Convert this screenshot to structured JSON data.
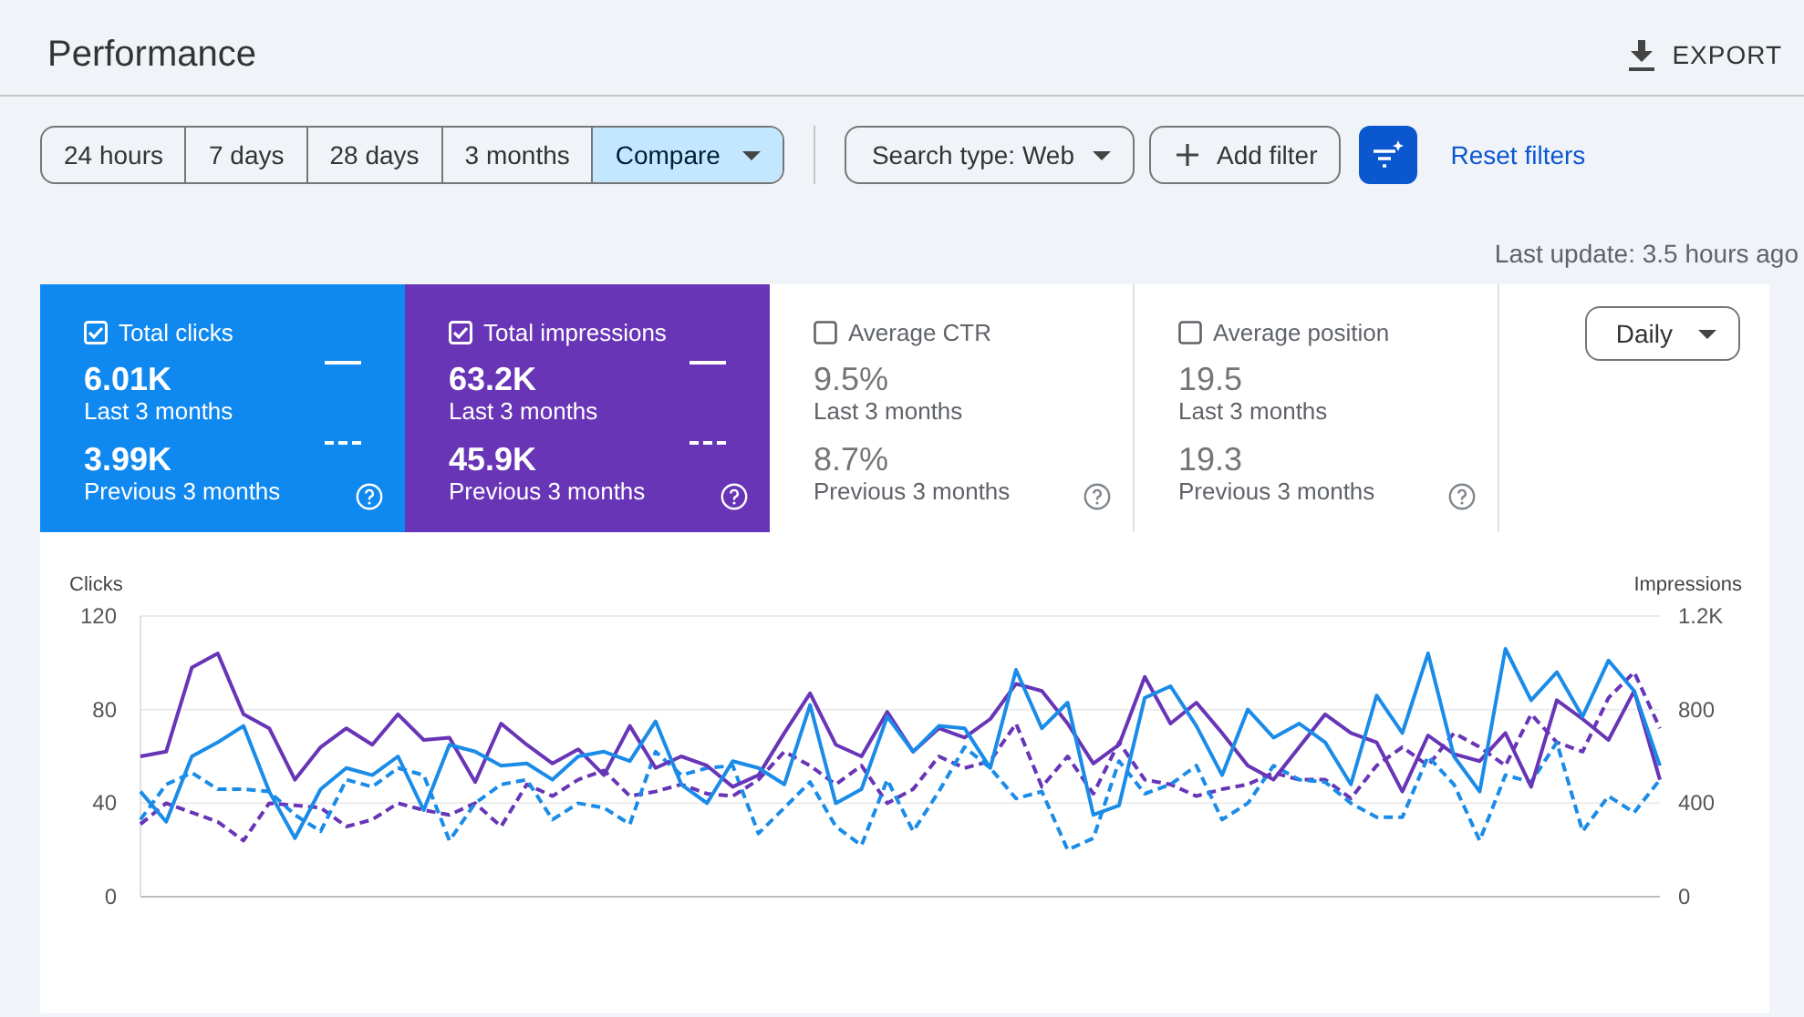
{
  "header": {
    "title": "Performance",
    "export_label": "EXPORT"
  },
  "date_ranges": [
    {
      "label": "24 hours",
      "selected": false,
      "kind": "option"
    },
    {
      "label": "7 days",
      "selected": false,
      "kind": "option"
    },
    {
      "label": "28 days",
      "selected": false,
      "kind": "option"
    },
    {
      "label": "3 months",
      "selected": false,
      "kind": "option"
    },
    {
      "label": "Compare",
      "selected": true,
      "kind": "dropdown"
    }
  ],
  "filters": {
    "search_type": "Search type: Web",
    "add_filter": "Add filter",
    "reset": "Reset filters"
  },
  "last_update": "Last update: 3.5 hours ago",
  "metrics": [
    {
      "label": "Total clicks",
      "checked": true,
      "color": "#0f88ef",
      "current": "6.01K",
      "current_period": "Last 3 months",
      "previous": "3.99K",
      "previous_period": "Previous 3 months"
    },
    {
      "label": "Total impressions",
      "checked": true,
      "color": "#6835b6",
      "current": "63.2K",
      "current_period": "Last 3 months",
      "previous": "45.9K",
      "previous_period": "Previous 3 months"
    },
    {
      "label": "Average CTR",
      "checked": false,
      "current": "9.5%",
      "current_period": "Last 3 months",
      "previous": "8.7%",
      "previous_period": "Previous 3 months"
    },
    {
      "label": "Average position",
      "checked": false,
      "current": "19.5",
      "current_period": "Last 3 months",
      "previous": "19.3",
      "previous_period": "Previous 3 months"
    }
  ],
  "granularity": "Daily",
  "chart": {
    "chart_data": {
      "type": "line",
      "ylabel": "Clicks",
      "y2label": "Impressions",
      "ylim": [
        0,
        120
      ],
      "y2lim": [
        0,
        1200
      ],
      "yticks": [
        0,
        40,
        80,
        120
      ],
      "y2ticks": [
        0,
        400,
        800,
        {
          "value": 1200,
          "label": "1.2K"
        }
      ],
      "series": [
        {
          "color": "#6835b6",
          "axis": "y2",
          "line_style": "dashed",
          "values": [
            310,
            400,
            360,
            320,
            240,
            400,
            390,
            380,
            300,
            330,
            400,
            370,
            350,
            400,
            300,
            480,
            430,
            500,
            540,
            430,
            450,
            480,
            440,
            430,
            500,
            620,
            560,
            480,
            560,
            400,
            460,
            600,
            550,
            580,
            740,
            470,
            600,
            440,
            660,
            500,
            480,
            430,
            460,
            480,
            530,
            500,
            500,
            420,
            560,
            640,
            560,
            700,
            640,
            560,
            780,
            660,
            620,
            850,
            960,
            720
          ]
        },
        {
          "color": "#1a8ce8",
          "line_style": "dashed",
          "values": [
            33,
            48,
            53,
            46,
            46,
            45,
            35,
            28,
            50,
            47,
            55,
            52,
            24,
            40,
            48,
            50,
            33,
            40,
            38,
            31,
            62,
            52,
            55,
            56,
            27,
            38,
            49,
            30,
            22,
            50,
            28,
            45,
            64,
            55,
            42,
            45,
            20,
            25,
            58,
            44,
            48,
            56,
            33,
            40,
            56,
            50,
            49,
            40,
            34,
            34,
            60,
            48,
            24,
            52,
            49,
            66,
            28,
            43,
            36,
            50
          ]
        },
        {
          "color": "#6835b6",
          "axis": "y2",
          "line_style": "solid",
          "values": [
            600,
            620,
            980,
            1040,
            780,
            720,
            500,
            640,
            720,
            650,
            780,
            670,
            680,
            490,
            740,
            650,
            570,
            630,
            520,
            730,
            550,
            600,
            560,
            470,
            520,
            700,
            870,
            650,
            600,
            790,
            620,
            720,
            680,
            760,
            910,
            880,
            740,
            570,
            650,
            940,
            740,
            830,
            700,
            560,
            500,
            640,
            780,
            700,
            660,
            450,
            690,
            610,
            580,
            700,
            470,
            840,
            760,
            670,
            880,
            500
          ]
        },
        {
          "color": "#1a8ce8",
          "line_style": "solid",
          "values": [
            45,
            32,
            60,
            66,
            73,
            45,
            25,
            46,
            55,
            52,
            60,
            37,
            65,
            62,
            56,
            57,
            50,
            60,
            62,
            58,
            75,
            48,
            40,
            58,
            55,
            48,
            82,
            40,
            46,
            77,
            62,
            73,
            72,
            55,
            97,
            72,
            83,
            35,
            39,
            85,
            90,
            73,
            52,
            80,
            68,
            74,
            66,
            48,
            86,
            70,
            104,
            60,
            45,
            106,
            84,
            96,
            77,
            101,
            88,
            56
          ]
        }
      ]
    }
  }
}
